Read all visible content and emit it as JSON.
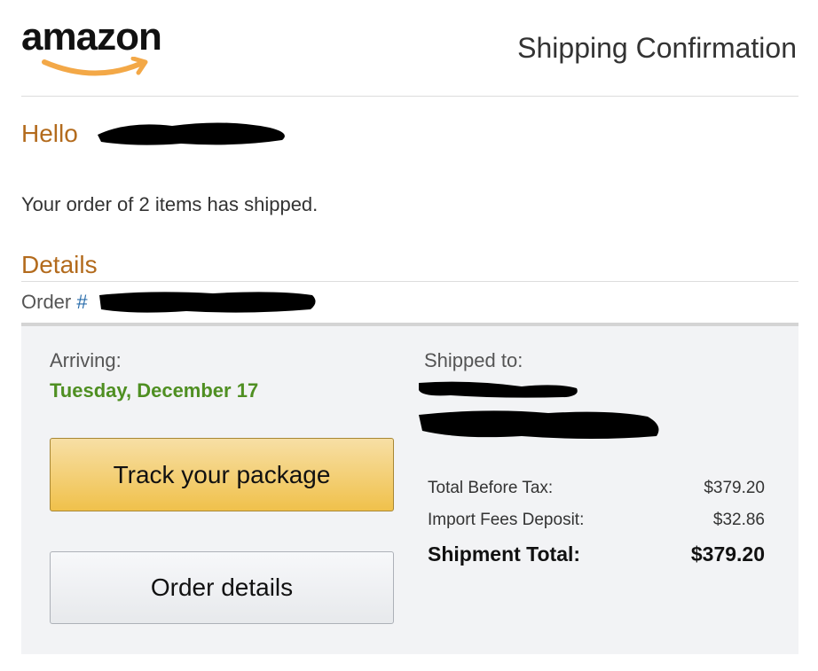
{
  "header": {
    "logo_text": "amazon",
    "title": "Shipping Confirmation"
  },
  "greeting": {
    "hello": "Hello",
    "message": "Your order of 2 items has shipped."
  },
  "details": {
    "heading": "Details",
    "order_label": "Order",
    "order_hash": "#"
  },
  "shipment": {
    "arriving_label": "Arriving:",
    "arriving_date": "Tuesday, December 17",
    "track_button": "Track your package",
    "order_details_button": "Order details",
    "shipped_to_label": "Shipped to:"
  },
  "summary": {
    "rows": [
      {
        "label": "Total Before Tax:",
        "value": "$379.20"
      },
      {
        "label": "Import Fees Deposit:",
        "value": "$32.86"
      },
      {
        "label": "Shipment Total:",
        "value": "$379.20"
      }
    ]
  },
  "colors": {
    "accent_orange": "#b36b1d",
    "arrival_green": "#4f8f22",
    "link_blue": "#2a6dab",
    "track_button": "#f0c14b"
  }
}
